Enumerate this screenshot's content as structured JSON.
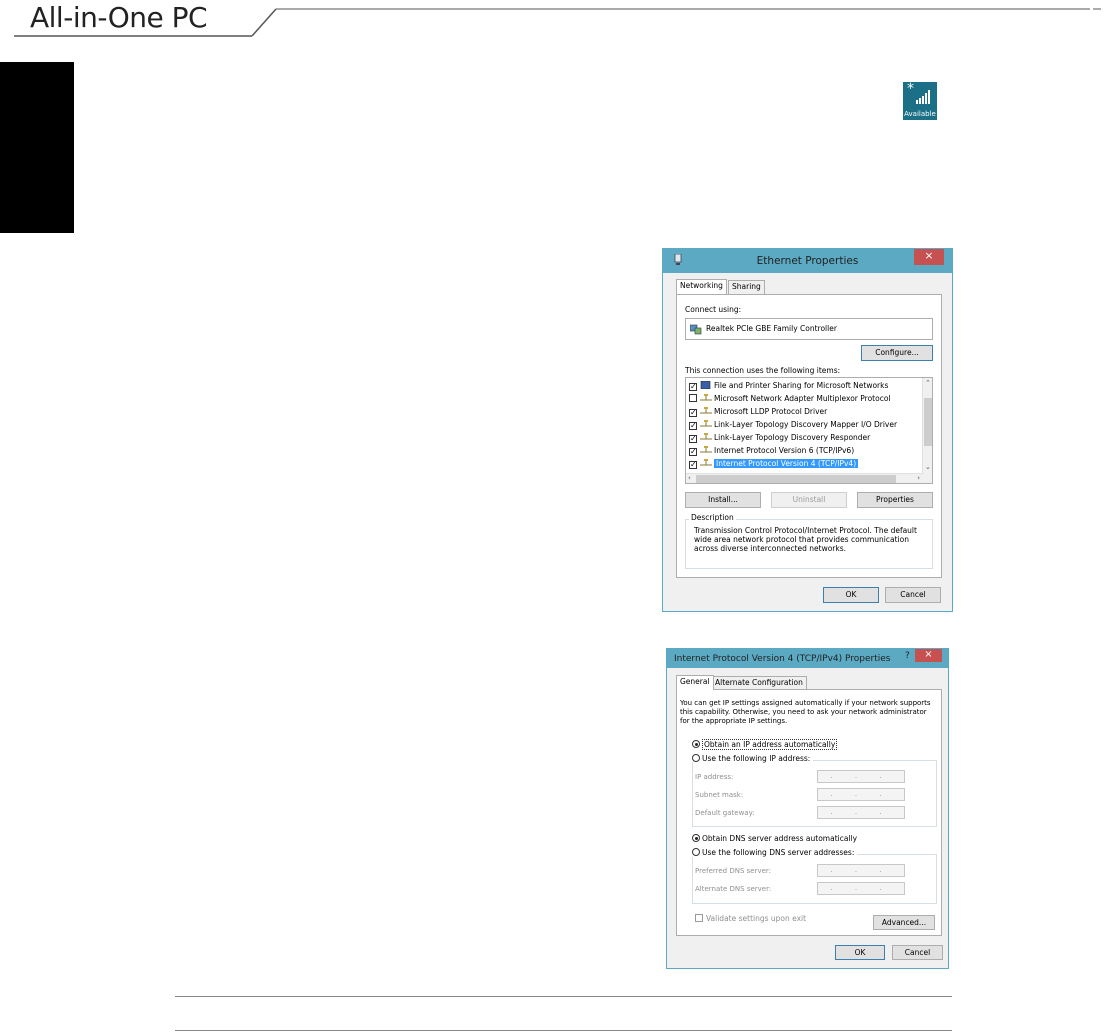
{
  "page": {
    "brand": "All-in-One PC",
    "network_tile_label": "Available"
  },
  "ethernet": {
    "title": "Ethernet Properties",
    "close": "×",
    "tabs": [
      "Networking",
      "Sharing"
    ],
    "connect_using": "Connect using:",
    "adapter": "Realtek PCIe GBE Family Controller",
    "configure": "Configure...",
    "items_label": "This connection uses the following items:",
    "items": [
      {
        "label": "File and Printer Sharing for Microsoft Networks",
        "checked": true
      },
      {
        "label": "Microsoft Network Adapter Multiplexor Protocol",
        "checked": false
      },
      {
        "label": "Microsoft LLDP Protocol Driver",
        "checked": true
      },
      {
        "label": "Link-Layer Topology Discovery Mapper I/O Driver",
        "checked": true
      },
      {
        "label": "Link-Layer Topology Discovery Responder",
        "checked": true
      },
      {
        "label": "Internet Protocol Version 6 (TCP/IPv6)",
        "checked": true
      },
      {
        "label": "Internet Protocol Version 4 (TCP/IPv4)",
        "checked": true
      }
    ],
    "install": "Install...",
    "uninstall": "Uninstall",
    "properties": "Properties",
    "description_label": "Description",
    "description_lines": [
      "Transmission Control Protocol/Internet Protocol. The default",
      "wide area network protocol that provides communication",
      "across diverse interconnected networks."
    ],
    "ok": "OK",
    "cancel": "Cancel"
  },
  "ipv4": {
    "title": "Internet Protocol Version 4 (TCP/IPv4) Properties",
    "help": "?",
    "close": "×",
    "tabs": [
      "General",
      "Alternate Configuration"
    ],
    "intro_lines": [
      "You can get IP settings assigned automatically if your network supports",
      "this capability. Otherwise, you need to ask your network administrator",
      "for the appropriate IP settings."
    ],
    "obtain_ip": "Obtain an IP address automatically",
    "use_ip": "Use the following IP address:",
    "ip_address": "IP address:",
    "subnet_mask": "Subnet mask:",
    "default_gateway": "Default gateway:",
    "ip_placeholder": ". . .",
    "obtain_dns": "Obtain DNS server address automatically",
    "use_dns": "Use the following DNS server addresses:",
    "preferred_dns": "Preferred DNS server:",
    "alternate_dns": "Alternate DNS server:",
    "validate": "Validate settings upon exit",
    "advanced": "Advanced...",
    "ok": "OK",
    "cancel": "Cancel"
  }
}
